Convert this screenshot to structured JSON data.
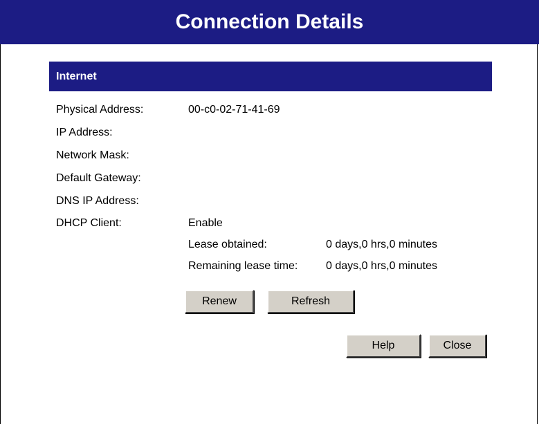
{
  "header": {
    "title": "Connection Details"
  },
  "section": {
    "title": "Internet"
  },
  "fields": [
    {
      "label": "Physical Address:",
      "value": "00-c0-02-71-41-69"
    },
    {
      "label": "IP Address:",
      "value": ""
    },
    {
      "label": "Network Mask:",
      "value": ""
    },
    {
      "label": "Default Gateway:",
      "value": ""
    },
    {
      "label": "DNS IP Address:",
      "value": ""
    },
    {
      "label": "DHCP Client:",
      "value": "Enable"
    }
  ],
  "lease": {
    "obtained_label": "Lease obtained:",
    "obtained_value": "0 days,0 hrs,0 minutes",
    "remaining_label": "Remaining lease time:",
    "remaining_value": "0 days,0 hrs,0 minutes"
  },
  "buttons": {
    "renew": "Renew",
    "refresh": "Refresh",
    "help": "Help",
    "close": "Close"
  }
}
